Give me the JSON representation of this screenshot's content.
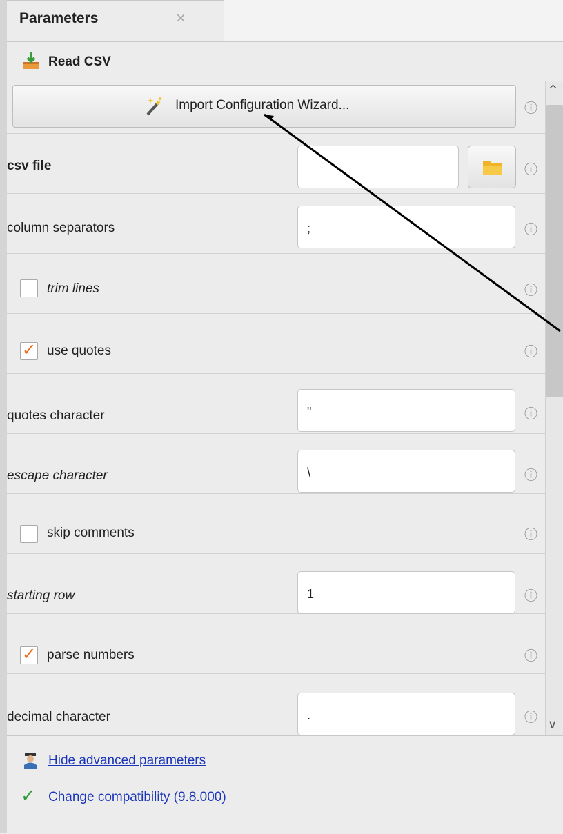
{
  "tab": {
    "title": "Parameters",
    "close_symbol": "×"
  },
  "operator": {
    "title": "Read CSV",
    "icon": "read-csv-icon"
  },
  "wizard": {
    "label": "Import Configuration Wizard...",
    "icon": "magic-wand-icon"
  },
  "info_symbol": "ⓘ",
  "params": [
    {
      "label": "csv file",
      "value": ""
    },
    {
      "label": "column separators",
      "value": ";"
    },
    {
      "label": "trim lines",
      "checked": false
    },
    {
      "label": "use quotes",
      "checked": true
    },
    {
      "label": "quotes character",
      "value": "\""
    },
    {
      "label": "escape character",
      "value": "\\"
    },
    {
      "label": "skip comments",
      "checked": false
    },
    {
      "label": "starting row",
      "value": "1"
    },
    {
      "label": "parse numbers",
      "checked": true
    },
    {
      "label": "decimal character",
      "value": "."
    }
  ],
  "checkmark": "✓",
  "scrollbar": {
    "up": "^",
    "down": "∨"
  },
  "footer": {
    "hide_advanced": "Hide advanced parameters",
    "change_compatibility": "Change compatibility (9.8.000)"
  },
  "colors": {
    "accent": "#ec6a1c",
    "link": "#1a35b8",
    "check_green": "#2e9c3a"
  }
}
